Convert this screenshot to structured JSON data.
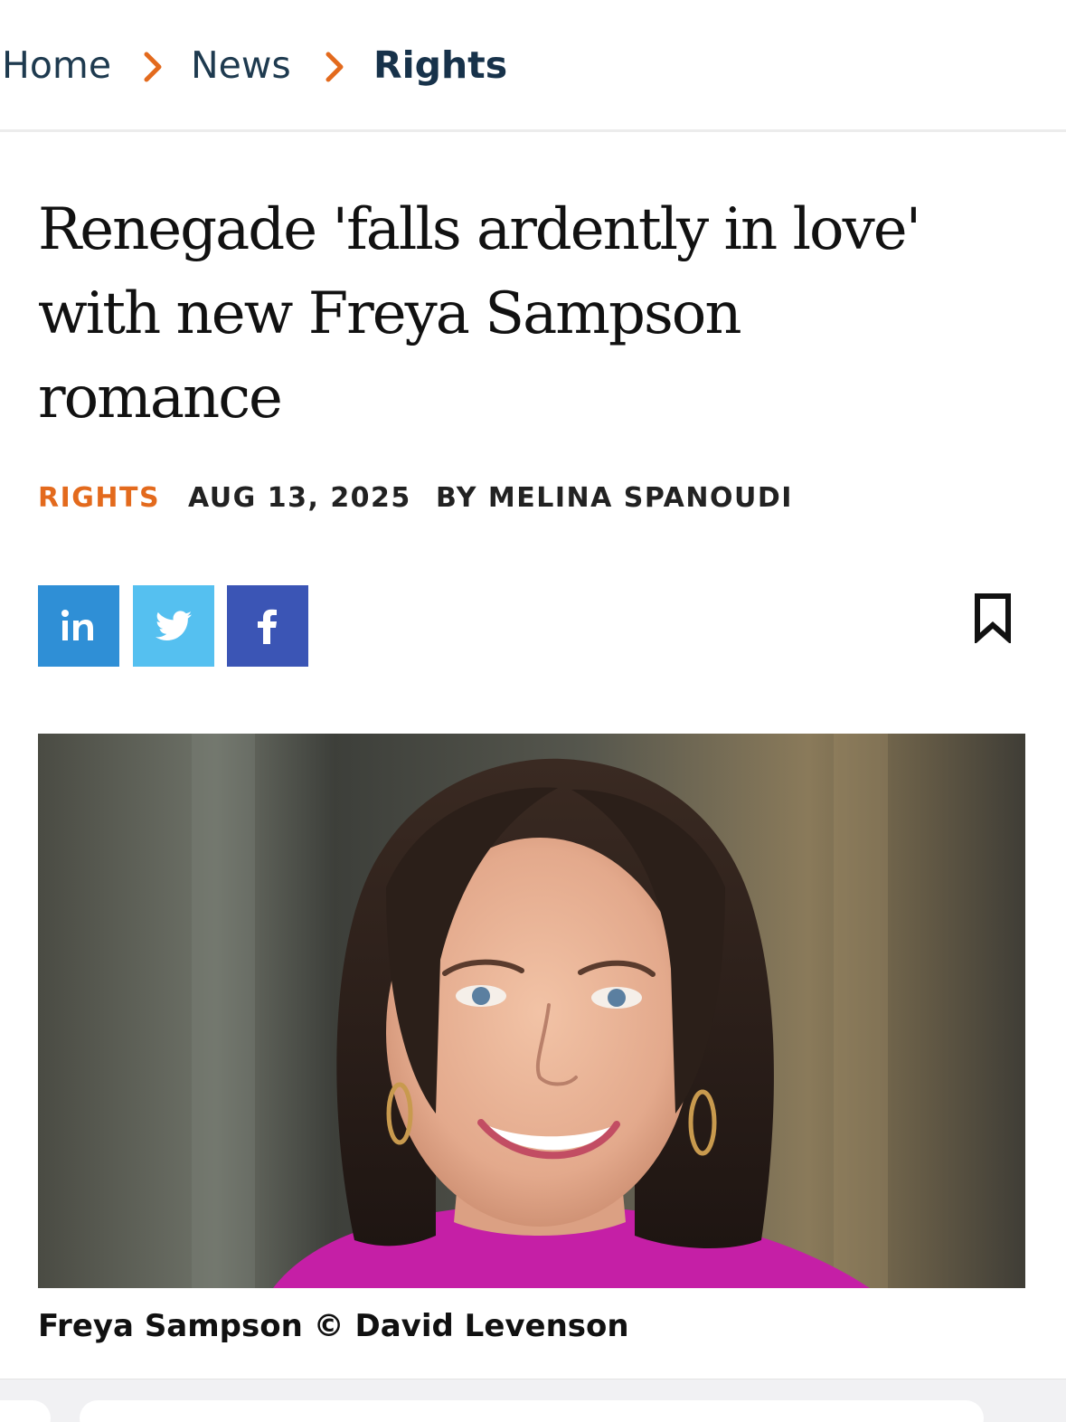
{
  "breadcrumb": {
    "items": [
      {
        "label": "Home"
      },
      {
        "label": "News"
      },
      {
        "label": "Rights"
      }
    ]
  },
  "article": {
    "title_lines": [
      "Renegade 'falls ardently in love'",
      "with new Freya Sampson",
      "romance"
    ],
    "category": "RIGHTS",
    "date": "AUG 13, 2025",
    "byline": "BY MELINA SPANOUDI",
    "image_caption": "Freya Sampson © David Levenson"
  },
  "share": {
    "icons": [
      "linkedin-icon",
      "twitter-icon",
      "facebook-icon"
    ]
  },
  "colors": {
    "accent_orange": "#e36a1d",
    "breadcrumb_text": "#1e3a4f",
    "linkedin": "#2f8fd6",
    "twitter": "#55c0f0",
    "facebook": "#3b55b5"
  }
}
